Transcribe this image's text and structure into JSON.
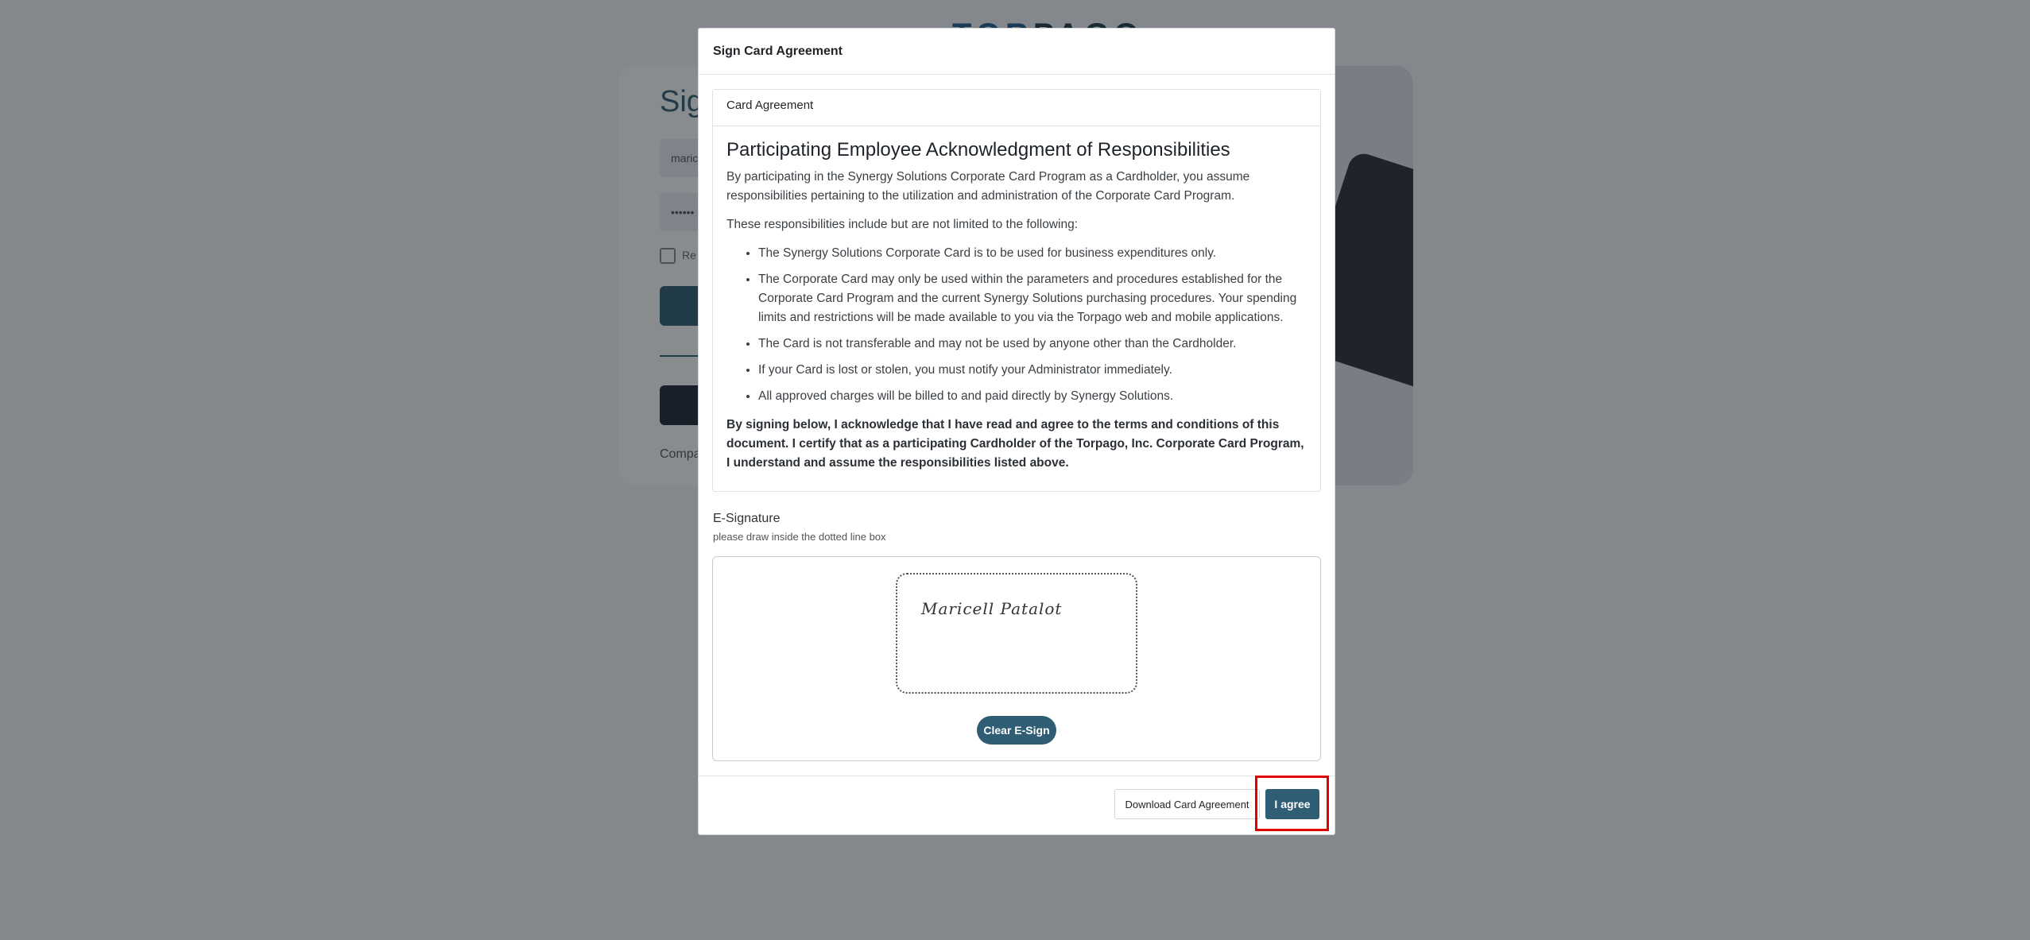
{
  "background": {
    "logo_text_accent": "TOR",
    "logo_text_rest": "PAGO",
    "title": "Sig",
    "email_value": "maric",
    "password_value": "••••••",
    "remember_label": "Re",
    "company_text": "Compa"
  },
  "modal": {
    "title": "Sign Card Agreement",
    "card_header": "Card Agreement",
    "heading": "Participating Employee Acknowledgment of Responsibilities",
    "intro": "By participating in the Synergy Solutions Corporate Card Program as a Cardholder, you assume responsibilities pertaining to the utilization and administration of the Corporate Card Program.",
    "list_intro": "These responsibilities include but are not limited to the following:",
    "items": [
      "The Synergy Solutions Corporate Card is to be used for business expenditures only.",
      "The Corporate Card may only be used within the parameters and procedures established for the Corporate Card Program and the current Synergy Solutions purchasing procedures. Your spending limits and restrictions will be made available to you via the Torpago web and mobile applications.",
      "The Card is not transferable and may not be used by anyone other than the Cardholder.",
      "If your Card is lost or stolen, you must notify your Administrator immediately.",
      "All approved charges will be billed to and paid directly by Synergy Solutions."
    ],
    "acknowledgment": "By signing below, I acknowledge that I have read and agree to the terms and conditions of this document. I certify that as a participating Cardholder of the Torpago, Inc. Corporate Card Program, I understand and assume the responsibilities listed above.",
    "esignature": {
      "title": "E-Signature",
      "instruction": "please draw inside the dotted line box",
      "signature_text": "Maricell Patalot",
      "clear_label": "Clear E-Sign"
    },
    "footer": {
      "download_label": "Download Card Agreement",
      "agree_label": "I agree"
    }
  },
  "colors": {
    "primary": "#2f5d73",
    "highlight": "#e00000",
    "backdrop": "rgba(20,26,32,0.5)"
  }
}
